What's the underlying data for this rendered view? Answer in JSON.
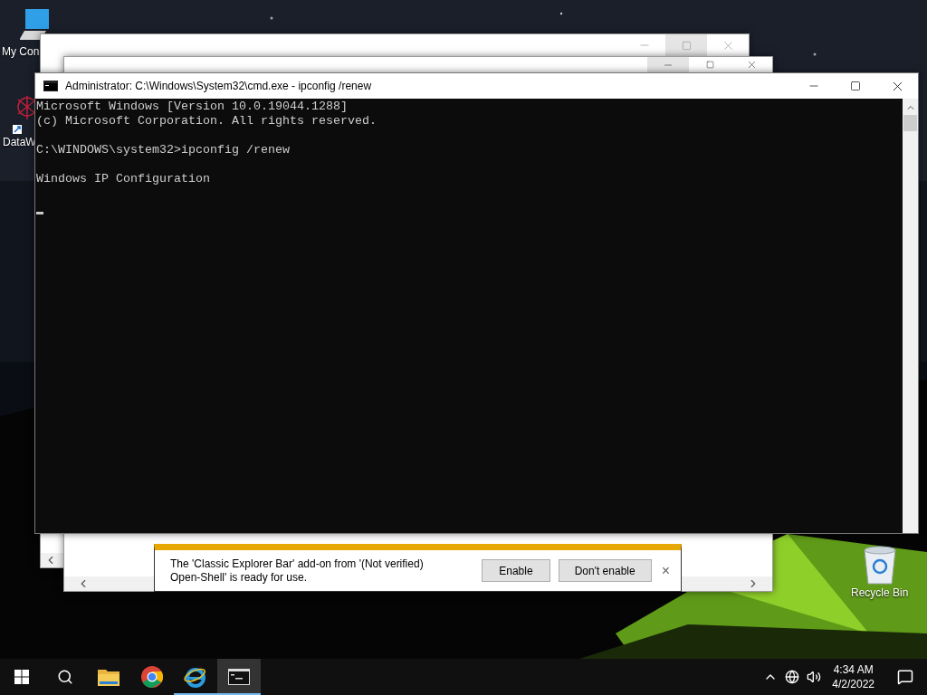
{
  "desktop_icons": [
    {
      "kind": "computer",
      "label": "My Con"
    },
    {
      "kind": "shortcut",
      "label": "DataW"
    },
    {
      "kind": "recycle",
      "label": "Recycle Bin"
    }
  ],
  "back_windows": [
    {
      "controls": [
        {
          "kind": "minimize",
          "hovered": false
        },
        {
          "kind": "maximize",
          "hovered": true
        },
        {
          "kind": "close",
          "hovered": false
        }
      ]
    },
    {
      "controls": [
        {
          "kind": "minimize",
          "hovered": true
        },
        {
          "kind": "maximize",
          "hovered": false
        },
        {
          "kind": "close",
          "hovered": false
        }
      ]
    }
  ],
  "console_window": {
    "title": "Administrator: C:\\Windows\\System32\\cmd.exe - ipconfig  /renew",
    "lines": [
      {
        "kind": "text",
        "text": "Microsoft Windows [Version 10.0.19044.1288]"
      },
      {
        "kind": "text",
        "text": "(c) Microsoft Corporation. All rights reserved."
      },
      {
        "kind": "blank"
      },
      {
        "kind": "text",
        "text": "C:\\WINDOWS\\system32>ipconfig /renew"
      },
      {
        "kind": "blank"
      },
      {
        "kind": "text",
        "text": "Windows IP Configuration"
      }
    ],
    "cursor": true
  },
  "notification_bar": {
    "message": "The 'Classic Explorer Bar' add-on from '(Not verified)\nOpen-Shell' is ready for use.",
    "buttons": [
      "Enable",
      "Don't enable"
    ],
    "close": "×"
  },
  "taskbar": {
    "apps": [
      {
        "kind": "start",
        "running": false,
        "active": false
      },
      {
        "kind": "search",
        "running": false,
        "active": false
      },
      {
        "kind": "folder",
        "running": false,
        "active": false
      },
      {
        "kind": "chrome",
        "running": false,
        "active": false
      },
      {
        "kind": "ie",
        "running": true,
        "active": false
      },
      {
        "kind": "console",
        "running": true,
        "active": true
      }
    ],
    "clock": {
      "time": "4:34 AM",
      "date": "4/2/2022"
    }
  }
}
